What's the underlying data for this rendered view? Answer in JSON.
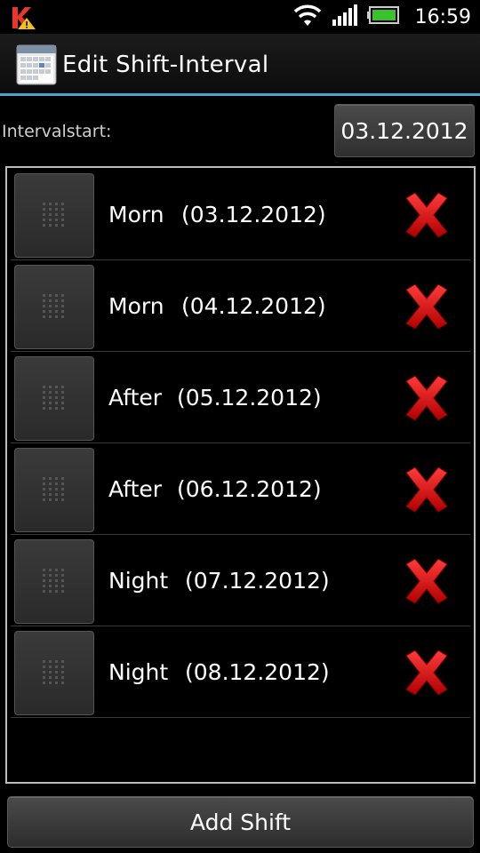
{
  "status_bar": {
    "time": "16:59",
    "icons": [
      "kaspersky-icon",
      "wifi-icon",
      "signal-icon",
      "battery-icon"
    ]
  },
  "title_bar": {
    "title": "Edit Shift-Interval",
    "icon": "calendar-icon"
  },
  "interval": {
    "label": "Intervalstart:",
    "date": "03.12.2012"
  },
  "shifts": [
    {
      "name": "Morn",
      "date": "(03.12.2012)"
    },
    {
      "name": "Morn",
      "date": "(04.12.2012)"
    },
    {
      "name": "After",
      "date": "(05.12.2012)"
    },
    {
      "name": "After",
      "date": "(06.12.2012)"
    },
    {
      "name": "Night",
      "date": "(07.12.2012)"
    },
    {
      "name": "Night",
      "date": "(08.12.2012)"
    }
  ],
  "add_button": {
    "label": "Add Shift"
  },
  "colors": {
    "accent": "#4aa6c8",
    "delete": "#e01010",
    "background": "#000000"
  }
}
